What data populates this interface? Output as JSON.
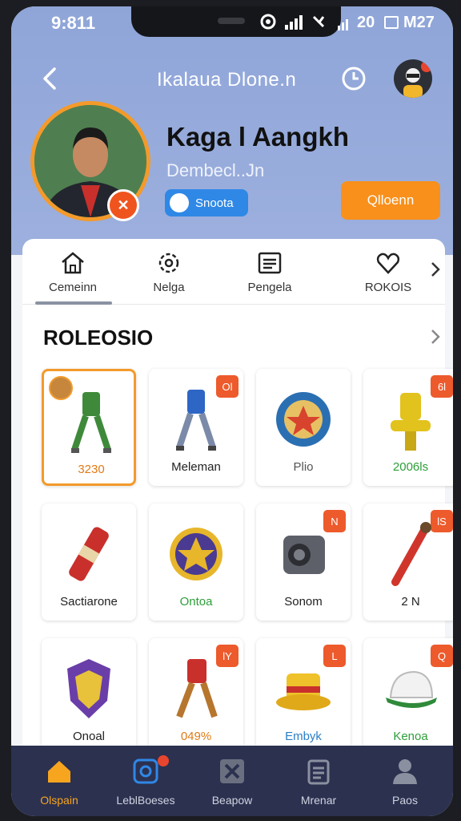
{
  "status_bar": {
    "time": "9:811",
    "right_text": "20",
    "right_extra": "M27"
  },
  "nav": {
    "title": "Ikalaua Dlone.n"
  },
  "profile": {
    "name": "Kaga l Aangkh",
    "handle": "Dembecl..Jn",
    "pill_label": "Snoota",
    "action_button": "Qlloenn"
  },
  "tabs": [
    {
      "label": "Cemeinn",
      "icon": "home-icon"
    },
    {
      "label": "Nelga",
      "icon": "gear-icon"
    },
    {
      "label": "Pengela",
      "icon": "list-icon"
    },
    {
      "label": "ROKOIS",
      "icon": "heart-icon"
    }
  ],
  "section": {
    "title": "ROLEOSIO"
  },
  "items": [
    {
      "label": "3230",
      "label_color": "#e07b14",
      "icon": "green-robot-icon",
      "selected": true,
      "tag": ""
    },
    {
      "label": "Meleman",
      "label_color": "#222222",
      "icon": "blue-robot-icon",
      "selected": false,
      "tag": "Ol"
    },
    {
      "label": "Plio",
      "label_color": "#555555",
      "icon": "shield-emblem-icon",
      "selected": false,
      "tag": ""
    },
    {
      "label": "2006ls",
      "label_color": "#2e9e3a",
      "icon": "yellow-robot-icon",
      "selected": false,
      "tag": "6l"
    },
    {
      "label": "Sactiarone",
      "label_color": "#222222",
      "icon": "red-tube-icon",
      "selected": false,
      "tag": ""
    },
    {
      "label": "Ontoa",
      "label_color": "#2e9e3a",
      "icon": "gold-badge-icon",
      "selected": false,
      "tag": ""
    },
    {
      "label": "Sonom",
      "label_color": "#222222",
      "icon": "camera-device-icon",
      "selected": false,
      "tag": "N"
    },
    {
      "label": "2 N",
      "label_color": "#222222",
      "icon": "red-stick-icon",
      "selected": false,
      "tag": "lS"
    },
    {
      "label": "Onoal",
      "label_color": "#222222",
      "icon": "purple-shield-icon",
      "selected": false,
      "tag": ""
    },
    {
      "label": "049%",
      "label_color": "#e07b14",
      "icon": "red-robot-icon",
      "selected": false,
      "tag": "lY"
    },
    {
      "label": "Embyk",
      "label_color": "#2a7fc8",
      "icon": "yellow-hat-icon",
      "selected": false,
      "tag": "L"
    },
    {
      "label": "Kenoa",
      "label_color": "#2e9e3a",
      "icon": "cap-icon",
      "selected": false,
      "tag": "Q"
    }
  ],
  "bottom_nav": [
    {
      "label": "Olspain",
      "icon": "home-icon",
      "active": true
    },
    {
      "label": "LeblBoeses",
      "icon": "instagram-icon",
      "active": false
    },
    {
      "label": "Beapow",
      "icon": "box-x-icon",
      "active": false
    },
    {
      "label": "Mrenar",
      "icon": "clipboard-icon",
      "active": false
    },
    {
      "label": "Paos",
      "icon": "person-icon",
      "active": false
    }
  ],
  "colors": {
    "accent": "#f8901b",
    "header": "#9db0de",
    "nav_bg": "#2c3150",
    "active": "#f7a51f"
  }
}
